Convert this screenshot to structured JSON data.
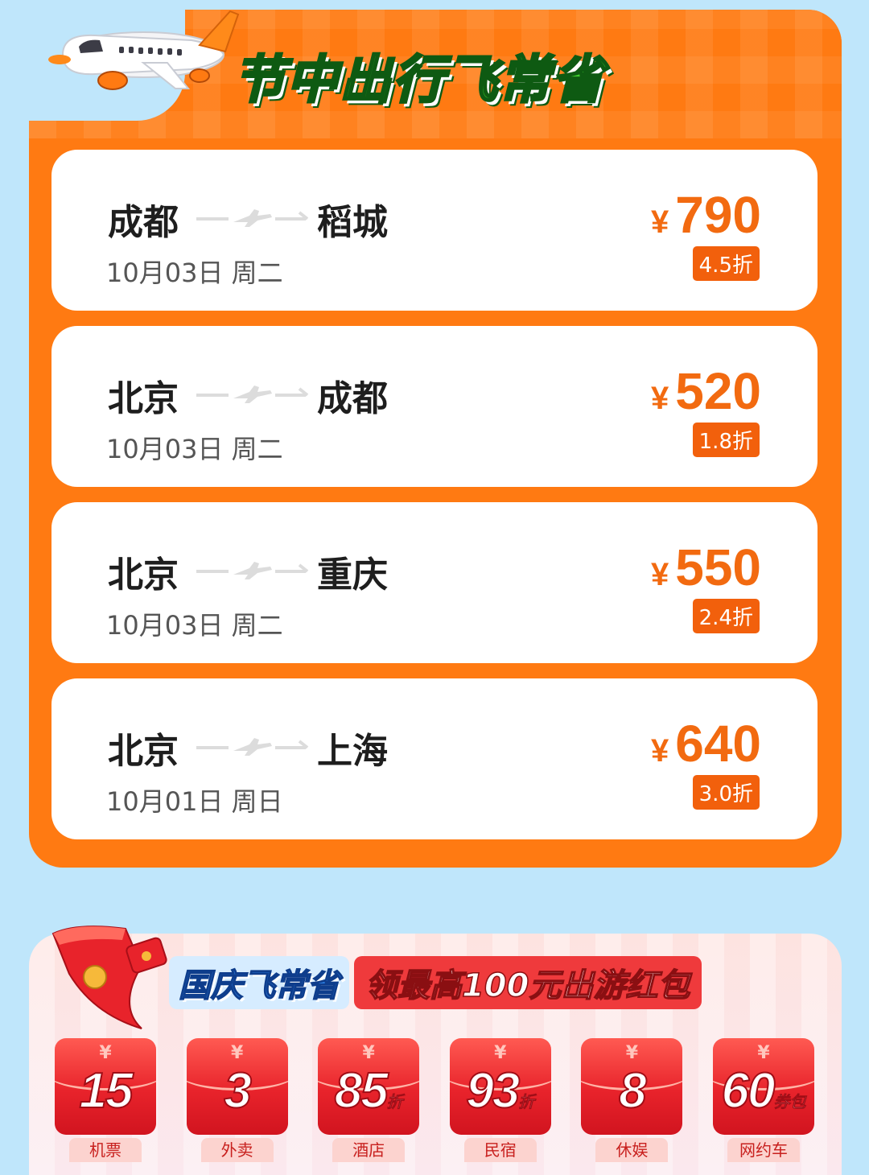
{
  "header": {
    "title": "节中出行飞常省"
  },
  "flights": [
    {
      "from": "成都",
      "to": "稻城",
      "date": "10月03日 周二",
      "currency": "¥",
      "price": "790",
      "discount": "4.5折"
    },
    {
      "from": "北京",
      "to": "成都",
      "date": "10月03日 周二",
      "currency": "¥",
      "price": "520",
      "discount": "1.8折"
    },
    {
      "from": "北京",
      "to": "重庆",
      "date": "10月03日 周二",
      "currency": "¥",
      "price": "550",
      "discount": "2.4折"
    },
    {
      "from": "北京",
      "to": "上海",
      "date": "10月01日 周日",
      "currency": "¥",
      "price": "640",
      "discount": "3.0折"
    }
  ],
  "promo": {
    "title_part1": "国庆飞常省",
    "title_part2": "领最高100元出游红包",
    "envelopes": [
      {
        "currency": "¥",
        "value": "15",
        "suffix": "",
        "label": "机票"
      },
      {
        "currency": "¥",
        "value": "3",
        "suffix": "",
        "label": "外卖"
      },
      {
        "currency": "¥",
        "value": "85",
        "suffix": "折",
        "label": "酒店"
      },
      {
        "currency": "¥",
        "value": "93",
        "suffix": "折",
        "label": "民宿"
      },
      {
        "currency": "¥",
        "value": "8",
        "suffix": "",
        "label": "休娱"
      },
      {
        "currency": "¥",
        "value": "60",
        "suffix": "券包",
        "label": "网约车"
      }
    ]
  },
  "colors": {
    "accent": "#ff7a12",
    "price": "#f26a10",
    "background": "#bfe6fb",
    "envelope": "#e8232b"
  }
}
